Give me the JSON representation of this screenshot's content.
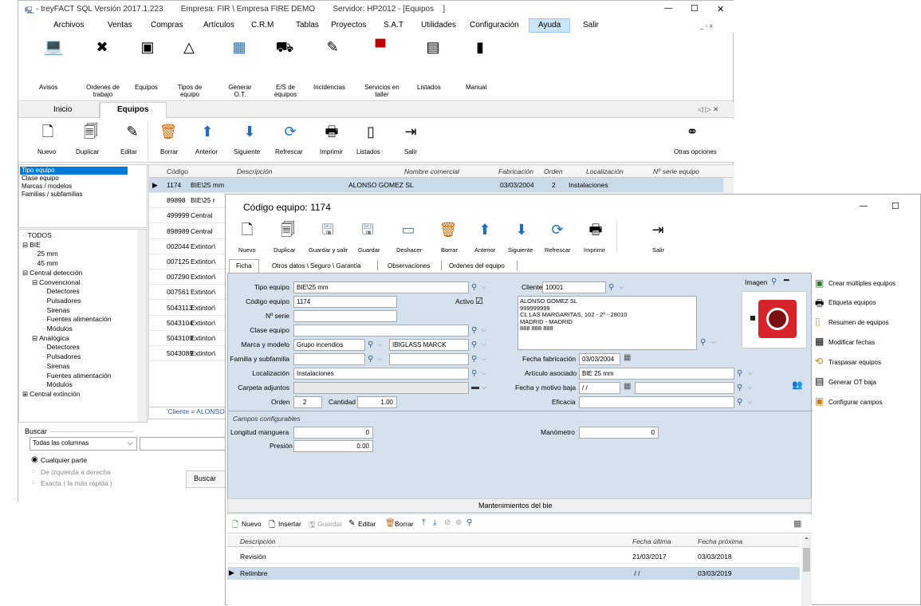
{
  "main_window": {
    "title": "- treyFACT SQL Versión 2017.1.223        Empresa: FIR \\ Empresa FIRE DEMO        Servidor: HP2012 - [Equipos    ]",
    "controls": {
      "minimize": "—",
      "maximize": "☐",
      "close": "✕"
    },
    "menu": [
      "Archivos",
      "Ventas",
      "Compras",
      "Artículos",
      "C.R.M",
      "Tablas",
      "Proyectos",
      "S.A.T",
      "Utilidades",
      "Configuración",
      "Ayuda",
      "Salir"
    ],
    "mdi_controls": "_ ▫ x",
    "ribbon": [
      {
        "label": "Avisos",
        "icon": "laptop-icon"
      },
      {
        "label": "Ordenes de trabajo",
        "icon": "tools-icon"
      },
      {
        "label": "Equipos",
        "icon": "equipment-icon"
      },
      {
        "label": "Tipos de equipo",
        "icon": "shapes-icon"
      },
      {
        "label": "Generar O.T.",
        "icon": "generate-icon"
      },
      {
        "label": "E/S de equipos",
        "icon": "cart-icon"
      },
      {
        "label": "Incidencias",
        "icon": "incident-icon"
      },
      {
        "label": "Servicios en taller",
        "icon": "drill-icon"
      },
      {
        "label": "Listados",
        "icon": "list-icon"
      },
      {
        "label": "Manual",
        "icon": "book-icon"
      }
    ],
    "tabs": [
      "Inicio",
      "Equipos"
    ],
    "tab_controls": "◁ ▷ ✕",
    "toolbar": [
      "Nuevo",
      "Duplicar",
      "Editar",
      "Borrar",
      "Anterior",
      "Siguiente",
      "Refrescar",
      "Imprimir",
      "Listados",
      "Salir"
    ],
    "other_options": "Otras opciones",
    "filter_list": [
      "Tipo equipo",
      "Clase equipo",
      "Marcas / modelos",
      "Familias / subfamilias"
    ],
    "tree": [
      {
        "label": "TODOS",
        "level": 0
      },
      {
        "label": "BIE",
        "level": 0,
        "expander": "⊟"
      },
      {
        "label": "25 mm",
        "level": 1
      },
      {
        "label": "45 mm",
        "level": 1
      },
      {
        "label": "Central detección",
        "level": 0,
        "expander": "⊟"
      },
      {
        "label": "Convencional",
        "level": 1,
        "expander": "⊟"
      },
      {
        "label": "Detectores",
        "level": 2
      },
      {
        "label": "Pulsadores",
        "level": 2
      },
      {
        "label": "Sirenas",
        "level": 2
      },
      {
        "label": "Fuentes alimentación",
        "level": 2
      },
      {
        "label": "Módulos",
        "level": 2
      },
      {
        "label": "Analógica",
        "level": 1,
        "expander": "⊟"
      },
      {
        "label": "Detectores",
        "level": 2
      },
      {
        "label": "Pulsadores",
        "level": 2
      },
      {
        "label": "Sirenas",
        "level": 2
      },
      {
        "label": "Fuentes alimentación",
        "level": 2
      },
      {
        "label": "Módulos",
        "level": 2
      },
      {
        "label": "Central extinción",
        "level": 0,
        "expander": "⊞"
      }
    ],
    "search": {
      "title": "Buscar",
      "columns_select": "Todas las columnas",
      "options": [
        "Cualquier parte",
        "De izquierda a derecha",
        "Exacta  ( la más rápida )"
      ],
      "button": "Buscar"
    },
    "grid": {
      "headers": [
        "Código",
        "Descripción",
        "Nombre comercial",
        "Fabricación",
        "Orden",
        "Localización",
        "Nº serie equipo"
      ],
      "rows": [
        [
          "1174",
          "BIE\\25 mm",
          "ALONSO GOMEZ SL",
          "03/03/2004",
          "2",
          "Instalaciones",
          ""
        ],
        [
          "89898",
          "BIE\\25 r",
          "",
          "",
          "",
          "",
          ""
        ],
        [
          "499999",
          "Central",
          "",
          "",
          "",
          "",
          ""
        ],
        [
          "898989",
          "Central",
          "",
          "",
          "",
          "",
          ""
        ],
        [
          "002044",
          "Extintor\\",
          "",
          "",
          "",
          "",
          ""
        ],
        [
          "007125",
          "Extintor\\",
          "",
          "",
          "",
          "",
          ""
        ],
        [
          "007290",
          "Extintor\\",
          "",
          "",
          "",
          "",
          ""
        ],
        [
          "007561",
          "Extintor\\",
          "",
          "",
          "",
          "",
          ""
        ],
        [
          "5043113",
          "Extintor\\",
          "",
          "",
          "",
          "",
          ""
        ],
        [
          "5043104",
          "Extintor\\",
          "",
          "",
          "",
          "",
          ""
        ],
        [
          "5043109",
          "Extintor\\",
          "",
          "",
          "",
          "",
          ""
        ],
        [
          "5043089",
          "Extintor\\",
          "",
          "",
          "",
          "",
          ""
        ]
      ],
      "filter_text": "'Cliente = ALONSO GOM"
    }
  },
  "detail_window": {
    "title": "Código equipo: 1174",
    "controls": {
      "minimize": "—",
      "maximize": "☐"
    },
    "toolbar": [
      "Nuevo",
      "Duplicar",
      "Guardar y salir",
      "Guardar",
      "Deshacer",
      "Borrar",
      "Anterior",
      "Siguiente",
      "Refrescar",
      "Imprimir",
      "Salir"
    ],
    "tabs": [
      "Ficha",
      "Otros datos \\ Seguro \\ Garantía",
      "Observaciones",
      "Ordenes del equipo"
    ],
    "labels": {
      "tipo_equipo": "Tipo equipo",
      "codigo_equipo": "Código equipo",
      "activo": "Activo",
      "n_serie": "Nº serie",
      "clase_equipo": "Clase equipo",
      "marca_modelo": "Marca y modelo",
      "familia": "Familia y subfamilia",
      "localizacion": "Localización",
      "carpeta": "Carpeta adjuntos",
      "orden": "Orden",
      "cantidad": "Cantidad",
      "cliente": "Cliente",
      "fecha_fab": "Fecha fabricación",
      "articulo": "Artículo asociado",
      "fecha_baja": "Fecha y motivo baja",
      "eficacia": "Eficacia",
      "imagen": "Imagen",
      "campos": "Campos configurables",
      "longitud": "Longitud manguera",
      "presion": "Presión",
      "manometro": "Manómetro"
    },
    "values": {
      "tipo_equipo": "BIE\\25 mm",
      "codigo_equipo": "1174",
      "activo_check": "☑",
      "n_serie": "",
      "clase_equipo": "",
      "marca": "Grupo incendios",
      "modelo": "IBIGLASS MARCK",
      "familia": "",
      "subfamilia": "",
      "localizacion": "Instalaciones",
      "carpeta": "",
      "orden": "2",
      "cantidad": "1.00",
      "cliente": "10001",
      "cliente_info": [
        "ALONSO GOMEZ SL",
        "999999999",
        "CL LAS MARGARITAS, 102 - 2º - 28010",
        "MADRID - MADRID",
        "888 888 888"
      ],
      "fecha_fab": "03/03/2004",
      "articulo": "BIE 25 mm",
      "fecha_baja": " / /",
      "motivo_baja": "",
      "eficacia": "",
      "longitud": "0",
      "presion": "0.00",
      "manometro": "0"
    },
    "maint": {
      "title": "Mantenimientos del bie",
      "toolbar": [
        "Nuevo",
        "Insertar",
        "Guardar",
        "Editar",
        "Borrar"
      ],
      "headers": [
        "Descripción",
        "Fecha última",
        "Fecha próxima"
      ],
      "rows": [
        [
          "Revisión",
          "21/03/2017",
          "03/03/2018"
        ],
        [
          "Retimbre",
          " / /",
          "03/03/2019"
        ]
      ]
    }
  },
  "side_actions": [
    "Crear múltiples equipos",
    "Etiqueta equipos",
    "Resumen de equipos",
    "Modificar fechas",
    "Traspasar equipos",
    "Generar OT baja",
    "Configurar campos"
  ],
  "colors": {
    "selection": "#0078d7",
    "form_bg": "#d5e2ee",
    "ribbon_bg": "#ffffff",
    "header_bg": "#f0f0f0",
    "selected_row": "#c9dbea"
  }
}
